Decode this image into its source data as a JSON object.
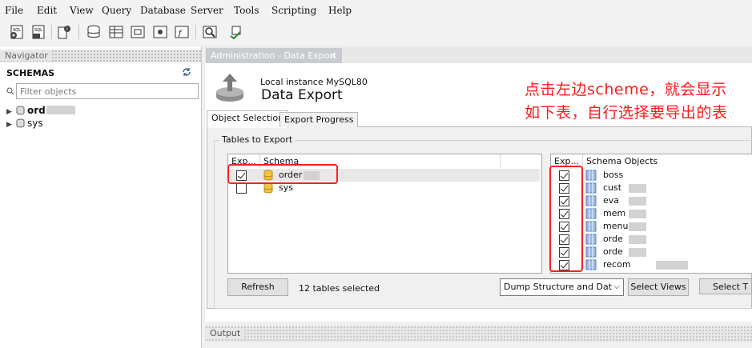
{
  "menu": [
    "File",
    "Edit",
    "View",
    "Query",
    "Database",
    "Server",
    "Tools",
    "Scripting",
    "Help"
  ],
  "toolbar": {
    "icons": [
      "new-sql-tab-icon",
      "open-sql-script-icon",
      "inspect-icon",
      "create-schema-icon",
      "create-table-icon",
      "create-view-icon",
      "create-procedure-icon",
      "create-function-icon",
      "search-table-data-icon",
      "reconnect-icon"
    ]
  },
  "navigator": {
    "header": "Navigator",
    "section_title": "SCHEMAS",
    "filter_placeholder": "Filter objects",
    "schemas": [
      "ord",
      "sys"
    ]
  },
  "main": {
    "tab_title": "Administration - Data Export",
    "instance": "Local instance MySQL80",
    "title": "Data Export",
    "subtabs": [
      "Object Selection",
      "Export Progress"
    ],
    "group_label": "Tables to Export",
    "schema_table": {
      "columns": [
        "Exp...",
        "Schema"
      ],
      "rows": [
        {
          "checked": true,
          "name": "order"
        },
        {
          "checked": false,
          "name": "sys"
        }
      ]
    },
    "objects_table": {
      "columns": [
        "Exp...",
        "Schema Objects"
      ],
      "rows": [
        {
          "checked": true,
          "name": "boss"
        },
        {
          "checked": true,
          "name": "cust"
        },
        {
          "checked": true,
          "name": "eva"
        },
        {
          "checked": true,
          "name": "mem"
        },
        {
          "checked": true,
          "name": "menu"
        },
        {
          "checked": true,
          "name": "orde"
        },
        {
          "checked": true,
          "name": "orde"
        },
        {
          "checked": true,
          "name": "recom"
        }
      ]
    },
    "refresh_label": "Refresh",
    "selected_count": "12 tables selected",
    "dump_option": "Dump Structure and Dat",
    "select_views_label": "Select Views",
    "select_tables_label": "Select T"
  },
  "output": {
    "header": "Output"
  },
  "annotation": "点击左边scheme，就会显示如下表，自行选择要导出的表",
  "colors": {
    "annotation": "#ff1a1a",
    "tab_active": "#c8ccd1"
  }
}
